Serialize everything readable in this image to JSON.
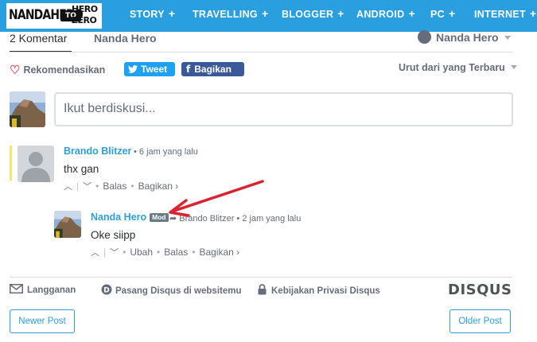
{
  "brand": {
    "logo_main": "NANDAHERO",
    "logo_top": "HERO",
    "logo_badge": "TO",
    "logo_bottom": "ZERO"
  },
  "nav": {
    "items": [
      {
        "label": "STORY"
      },
      {
        "label": "TRAVELLING"
      },
      {
        "label": "BLOGGER"
      },
      {
        "label": "ANDROID"
      },
      {
        "label": "PC"
      },
      {
        "label": "INTERNET"
      }
    ],
    "plus": "+"
  },
  "disqus": {
    "comment_count_tab": "2 Komentar",
    "community_tab": "Nanda Hero",
    "account_name": "Nanda Hero",
    "recommend_label": "Rekomendasikan",
    "tweet_label": "Tweet",
    "share_label": "Bagikan",
    "sort_label": "Urut dari yang Terbaru",
    "composer_placeholder": "Ikut berdiskusi...",
    "comments": [
      {
        "author": "Brando Blitzer",
        "time": "6 jam yang lalu",
        "text": "thx gan",
        "actions": [
          "Balas",
          "Bagikan ›"
        ]
      },
      {
        "author": "Nanda Hero",
        "badge": "Mod",
        "reply_to": "Brando Blitzer",
        "time": "2 jam yang lalu",
        "text": "Oke siipp",
        "actions": [
          "Ubah",
          "Balas",
          "Bagikan ›"
        ]
      }
    ],
    "footer": {
      "subscribe": "Langganan",
      "add_disqus": "Pasang Disqus di websitemu",
      "privacy": "Kebijakan Privasi Disqus",
      "logo": "DISQUS"
    }
  },
  "pager": {
    "newer": "Newer Post",
    "older": "Older Post"
  },
  "colors": {
    "nav_bg": "#2a9fe0",
    "link": "#2ea0d8",
    "tweet": "#1da1f2",
    "facebook": "#3b5998",
    "annotation_arrow": "#d9232e",
    "highlight": "#f6e66a"
  },
  "icons": [
    "heart-icon",
    "twitter-bird-icon",
    "facebook-f-icon",
    "chat-bubble-icon",
    "envelope-icon",
    "disqus-d-icon",
    "padlock-icon",
    "reply-arrow-icon",
    "upvote-icon",
    "downvote-icon",
    "annotation-arrow"
  ]
}
